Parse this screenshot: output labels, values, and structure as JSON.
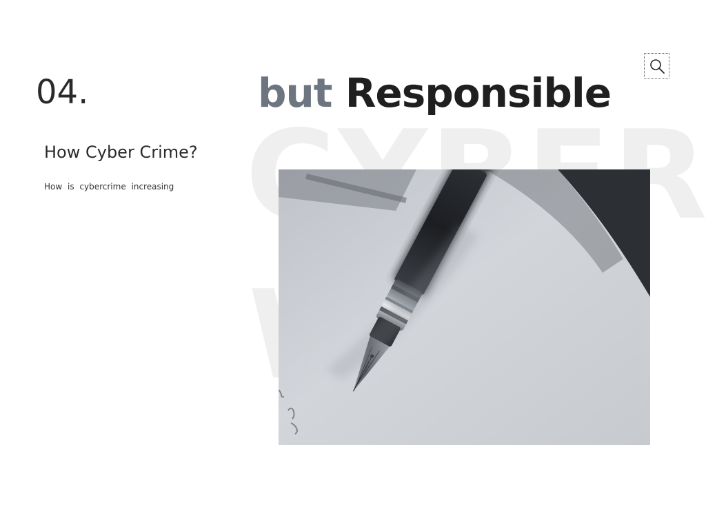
{
  "section": {
    "number": "04."
  },
  "headline": {
    "muted": "but",
    "strong": "Responsible"
  },
  "background_words": {
    "line1": "CYBER",
    "line2": "W"
  },
  "content": {
    "subheading": "How Cyber Crime?",
    "body": "How is cybercrime increasing"
  },
  "icons": {
    "search": "search-icon",
    "photo": "fountain-pen-photo"
  }
}
